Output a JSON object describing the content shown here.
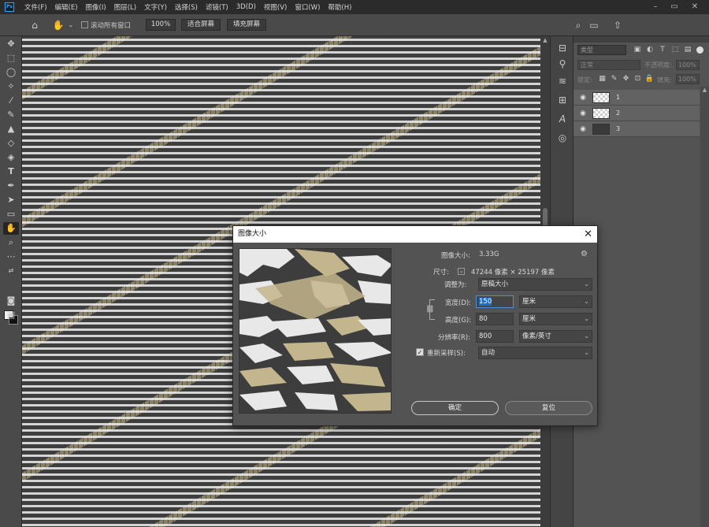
{
  "menubar": {
    "items": [
      "文件(F)",
      "编辑(E)",
      "图像(I)",
      "图层(L)",
      "文字(Y)",
      "选择(S)",
      "滤镜(T)",
      "3D(D)",
      "视图(V)",
      "窗口(W)",
      "帮助(H)"
    ],
    "logo": "Ps"
  },
  "options": {
    "scroll_all_label": "滚动所有窗口",
    "zoom_value": "100%",
    "fit_screen": "适合屏幕",
    "fill_screen": "填充屏幕"
  },
  "layers_panel": {
    "search_placeholder": "类型",
    "blend_mode": "正常",
    "opacity_label": "不透明度:",
    "opacity_value": "100%",
    "lock_label": "锁定:",
    "fill_label": "填充:",
    "fill_value": "100%",
    "layers": [
      {
        "name": "1",
        "thumb": "checker"
      },
      {
        "name": "2",
        "thumb": "checker"
      },
      {
        "name": "3",
        "thumb": "dark"
      }
    ]
  },
  "dialog": {
    "title": "图像大小",
    "image_size_label": "图像大小:",
    "image_size_value": "3.33G",
    "dimensions_label": "尺寸:",
    "dimensions_value": "47244 像素 × 25197 像素",
    "fit_to_label": "调整为:",
    "fit_to_value": "原稿大小",
    "width_label": "宽度(D):",
    "width_value": "150",
    "width_unit": "厘米",
    "height_label": "高度(G):",
    "height_value": "80",
    "height_unit": "厘米",
    "resolution_label": "分辨率(R):",
    "resolution_value": "800",
    "resolution_unit": "像素/英寸",
    "resample_label": "重新采样(S):",
    "resample_value": "自动",
    "ok_label": "确定",
    "reset_label": "复位"
  },
  "colors": {
    "pattern_beige": "#c4b68c",
    "pattern_dark": "#3e3e3e",
    "pattern_light": "#eeeeee",
    "focus_blue": "#1f6ecf"
  }
}
